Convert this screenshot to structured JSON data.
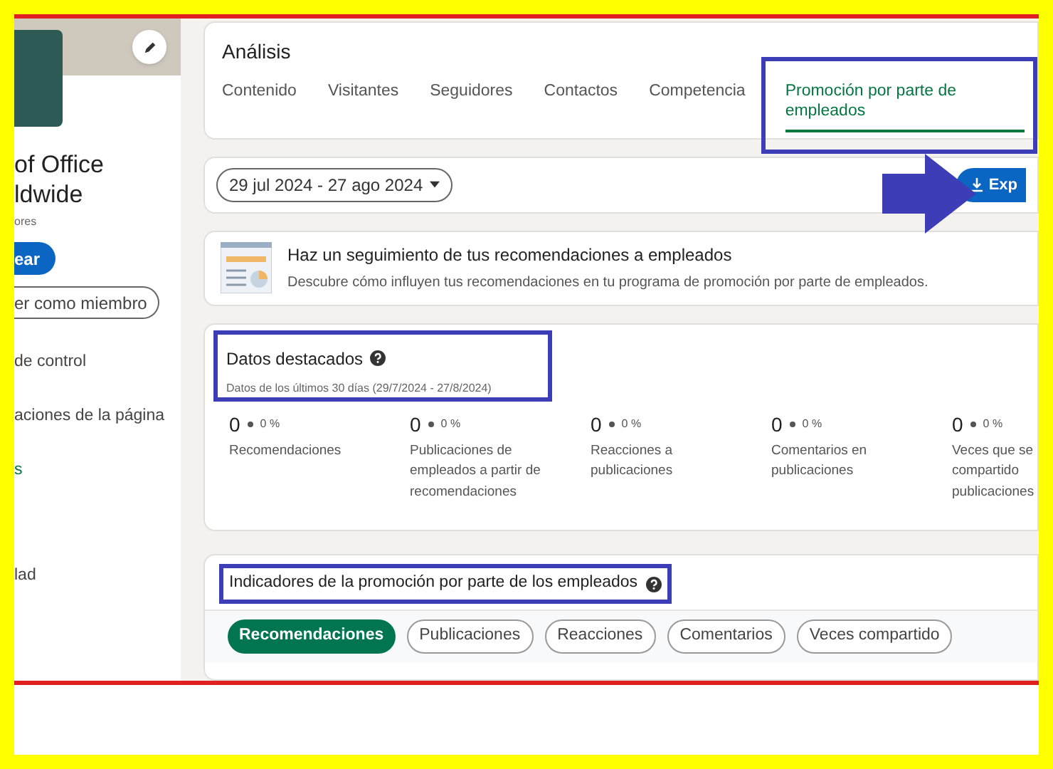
{
  "sidebar": {
    "page_name_lines": [
      "of Office",
      "ldwide"
    ],
    "followers": "ores",
    "primary_button": "ear",
    "secondary_button": "er como miembro",
    "nav": [
      {
        "label": "de control",
        "selected": false
      },
      {
        "label": "aciones de la página",
        "selected": false
      },
      {
        "label": "s",
        "selected": true
      },
      {
        "label": "lad",
        "selected": false
      }
    ]
  },
  "header": {
    "title": "Análisis",
    "tabs": [
      {
        "label": "Contenido",
        "selected": false
      },
      {
        "label": "Visitantes",
        "selected": false
      },
      {
        "label": "Seguidores",
        "selected": false
      },
      {
        "label": "Contactos",
        "selected": false
      },
      {
        "label": "Competencia",
        "selected": false
      },
      {
        "label": "Promoción por parte de empleados",
        "selected": true
      }
    ]
  },
  "date_range": "29 jul 2024 - 27 ago 2024",
  "export_button": "Exp",
  "banner": {
    "title": "Haz un seguimiento de tus recomendaciones a empleados",
    "description": "Descubre cómo influyen tus recomendaciones en tu programa de promoción por parte de empleados."
  },
  "highlights": {
    "title": "Datos destacados",
    "subtitle": "Datos de los últimos 30 días (29/7/2024 - 27/8/2024)",
    "stats": [
      {
        "value": "0",
        "change": "0 %",
        "label": "Recomendaciones"
      },
      {
        "value": "0",
        "change": "0 %",
        "label": "Publicaciones de empleados a partir de recomendaciones"
      },
      {
        "value": "0",
        "change": "0 %",
        "label": "Reacciones a publicaciones"
      },
      {
        "value": "0",
        "change": "0 %",
        "label": "Comentarios en publicaciones"
      },
      {
        "value": "0",
        "change": "0 %",
        "label": "Veces que se compartido publicaciones"
      }
    ]
  },
  "indicators": {
    "title": "Indicadores de la promoción por parte de los empleados",
    "filters": [
      {
        "label": "Recomendaciones",
        "selected": true
      },
      {
        "label": "Publicaciones",
        "selected": false
      },
      {
        "label": "Reacciones",
        "selected": false
      },
      {
        "label": "Comentarios",
        "selected": false
      },
      {
        "label": "Veces compartido",
        "selected": false
      }
    ]
  }
}
